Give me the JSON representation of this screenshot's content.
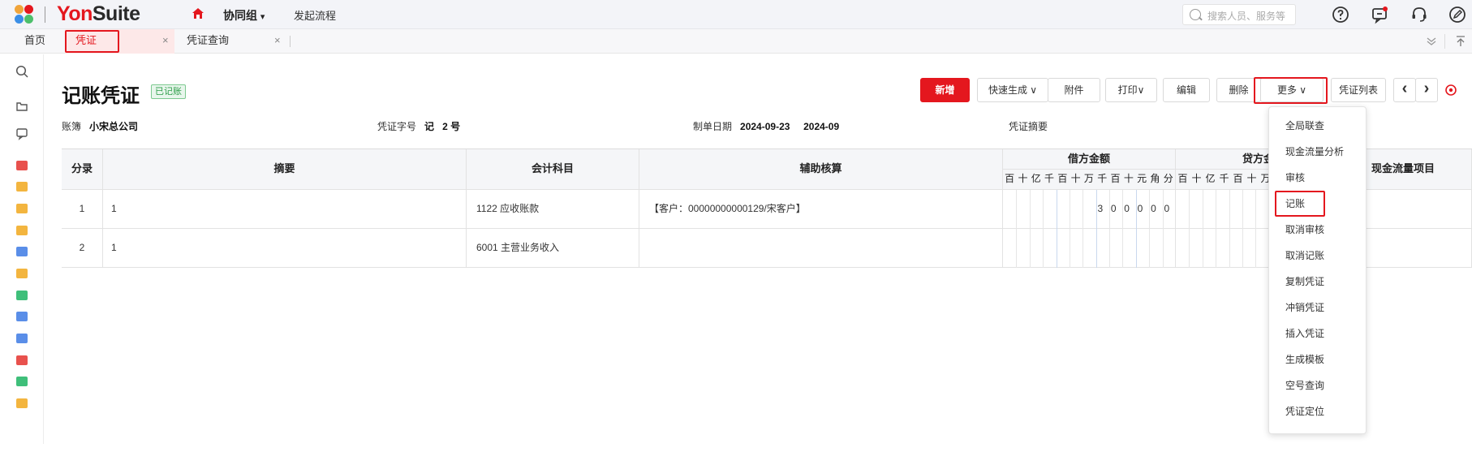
{
  "topbar": {
    "brand_prefix": "Yon",
    "brand_suffix": "Suite",
    "group_label": "协同组",
    "group_arrow": "▾",
    "flow_link": "发起流程",
    "search_placeholder": "搜索人员、服务等"
  },
  "tabs": {
    "home": "首页",
    "voucher": "凭证",
    "voucher_query": "凭证查询",
    "close": "×"
  },
  "page": {
    "title": "记账凭证",
    "status_badge": "已记账"
  },
  "toolbar": {
    "new": "新增",
    "quick_generate": "快速生成 ∨",
    "attachment": "附件",
    "print": "打印∨",
    "edit": "编辑",
    "delete": "删除",
    "more": "更多 ∨",
    "voucher_list": "凭证列表",
    "prev": "‹",
    "next": "›"
  },
  "meta": {
    "book_label": "账簿",
    "book_value": "小宋总公司",
    "voucher_no_label": "凭证字号",
    "voucher_word": "记",
    "voucher_number": "2",
    "voucher_no_unit": "号",
    "date_label": "制单日期",
    "date_value": "2024-09-23",
    "period_value": "2024-09",
    "summary_label": "凭证摘要"
  },
  "table": {
    "headers": {
      "entry": "分录",
      "summary": "摘要",
      "account": "会计科目",
      "auxiliary": "辅助核算",
      "debit": "借方金额",
      "credit": "贷方金",
      "cashflow": "现金流量项目"
    },
    "digit_units_debit": [
      "百",
      "十",
      "亿",
      "千",
      "百",
      "十",
      "万",
      "千",
      "百",
      "十",
      "元",
      "角",
      "分"
    ],
    "digit_units_credit": [
      "百",
      "十",
      "亿",
      "千",
      "百",
      "十",
      "万"
    ],
    "rows": [
      {
        "no": "1",
        "summary": "1",
        "account": "1122 应收账款",
        "auxiliary": "【客户：00000000000129/宋客户】",
        "debit_digits": [
          "3",
          "0",
          "0",
          "0",
          "0",
          "0"
        ]
      },
      {
        "no": "2",
        "summary": "1",
        "account": "6001 主营业务收入",
        "auxiliary": "",
        "debit_digits": []
      }
    ]
  },
  "more_menu": {
    "items": [
      "全局联查",
      "现金流量分析",
      "审核",
      "记账",
      "取消审核",
      "取消记账",
      "复制凭证",
      "冲销凭证",
      "插入凭证",
      "生成模板",
      "空号查询",
      "凭证定位"
    ]
  },
  "colors": {
    "brand_red": "#e4171e",
    "badge_green": "#2e9e4a"
  }
}
